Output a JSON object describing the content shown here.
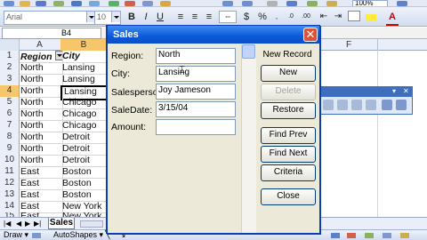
{
  "toolbar": {
    "font_name": "Arial",
    "font_size": "10",
    "zoom": "100%",
    "bold": "B",
    "italic": "I",
    "underline": "U",
    "currency": "$",
    "percent": "%"
  },
  "formula_bar": {
    "cell_ref": "B4"
  },
  "columns": [
    "A",
    "B",
    "F"
  ],
  "rows": [
    {
      "n": "1",
      "a": "Region",
      "b": "City"
    },
    {
      "n": "2",
      "a": "North",
      "b": "Lansing"
    },
    {
      "n": "3",
      "a": "North",
      "b": "Lansing"
    },
    {
      "n": "4",
      "a": "North",
      "b": "Lansing"
    },
    {
      "n": "5",
      "a": "North",
      "b": "Chicago"
    },
    {
      "n": "6",
      "a": "North",
      "b": "Chicago"
    },
    {
      "n": "7",
      "a": "North",
      "b": "Chicago"
    },
    {
      "n": "8",
      "a": "North",
      "b": "Detroit"
    },
    {
      "n": "9",
      "a": "North",
      "b": "Detroit"
    },
    {
      "n": "10",
      "a": "North",
      "b": "Detroit"
    },
    {
      "n": "11",
      "a": "East",
      "b": "Boston"
    },
    {
      "n": "12",
      "a": "East",
      "b": "Boston"
    },
    {
      "n": "13",
      "a": "East",
      "b": "Boston"
    },
    {
      "n": "14",
      "a": "East",
      "b": "New York"
    },
    {
      "n": "15",
      "a": "East",
      "b": "New York"
    }
  ],
  "sheet_tab": "Sales",
  "draw_bar": {
    "draw": "Draw",
    "autoshapes": "AutoShapes"
  },
  "dialog": {
    "title": "Sales",
    "record_status": "New Record",
    "fields": [
      {
        "label": "Region:",
        "value": "North"
      },
      {
        "label": "City:",
        "value": "Lansing"
      },
      {
        "label": "Salesperson:",
        "value": "Joy Jameson"
      },
      {
        "label": "SaleDate:",
        "value": "3/15/04"
      },
      {
        "label": "Amount:",
        "value": ""
      }
    ],
    "buttons": {
      "new": "New",
      "delete": "Delete",
      "restore": "Restore",
      "find_prev": "Find Prev",
      "find_next": "Find Next",
      "criteria": "Criteria",
      "close": "Close"
    }
  }
}
